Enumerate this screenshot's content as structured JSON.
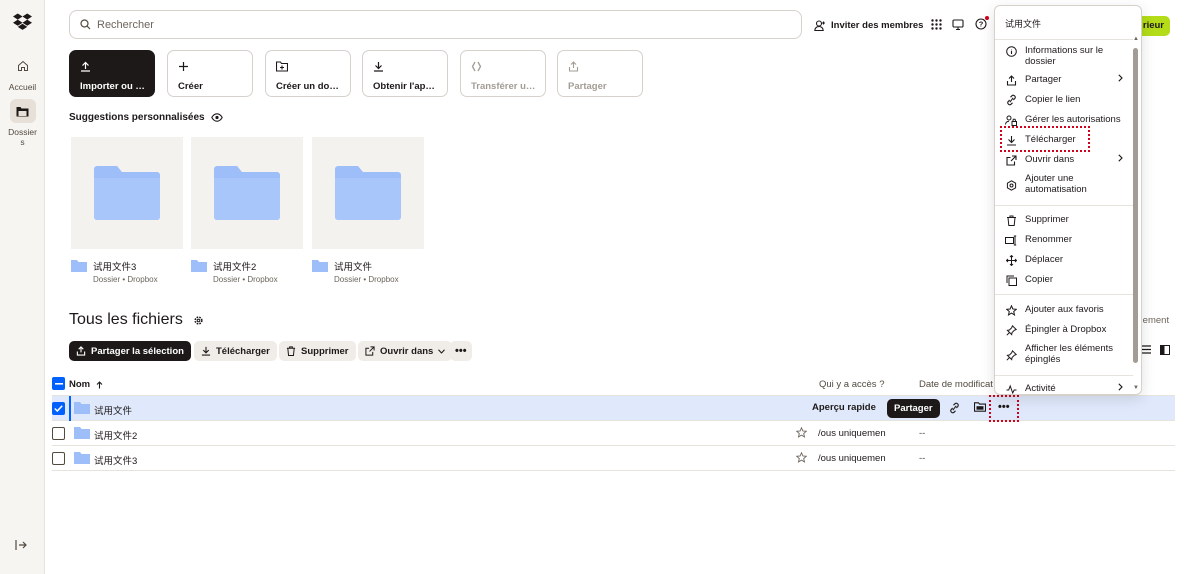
{
  "nav": {
    "home_label": "Accueil",
    "folders_label": "Dossiers"
  },
  "search": {
    "placeholder": "Rechercher"
  },
  "header": {
    "invite_label": "Inviter des membres",
    "upgrade_label": "rieur"
  },
  "actions": [
    {
      "label": "Importer ou dé…",
      "icon": "upload-icon"
    },
    {
      "label": "Créer",
      "icon": "plus-icon"
    },
    {
      "label": "Créer un dossier",
      "icon": "new-folder-icon"
    },
    {
      "label": "Obtenir l'applic…",
      "icon": "download-icon"
    },
    {
      "label": "Transférer une …",
      "icon": "transfer-icon"
    },
    {
      "label": "Partager",
      "icon": "share-icon"
    }
  ],
  "suggestions": {
    "title": "Suggestions personnalisées",
    "items": [
      {
        "name": "试用文件3",
        "sub": "Dossier • Dropbox"
      },
      {
        "name": "试用文件2",
        "sub": "Dossier • Dropbox"
      },
      {
        "name": "试用文件",
        "sub": "Dossier • Dropbox"
      }
    ]
  },
  "files": {
    "title": "Tous les fichiers",
    "partial_label": "iquement",
    "toolbar": {
      "share_selection": "Partager la sélection",
      "download": "Télécharger",
      "delete": "Supprimer",
      "open_in": "Ouvrir dans"
    },
    "columns": {
      "name": "Nom",
      "access": "Qui y a accès ?",
      "modified": "Date de modificat"
    },
    "rows": [
      {
        "name": "试用文件",
        "access": "",
        "date": "",
        "selected": true
      },
      {
        "name": "试用文件2",
        "access": "/ous uniquemen",
        "date": "--",
        "selected": false
      },
      {
        "name": "试用文件3",
        "access": "/ous uniquemen",
        "date": "--",
        "selected": false
      }
    ],
    "row_actions": {
      "preview": "Aperçu rapide",
      "share": "Partager"
    }
  },
  "menu": {
    "title": "试用文件",
    "items": [
      {
        "label": "Informations sur le dossier",
        "icon": "info-icon"
      },
      {
        "label": "Partager",
        "icon": "share-icon"
      },
      {
        "label": "Copier le lien",
        "icon": "link-icon"
      },
      {
        "label": "Gérer les autorisations",
        "icon": "permissions-icon"
      },
      {
        "label": "Télécharger",
        "icon": "download-icon"
      },
      {
        "label": "Ouvrir dans",
        "icon": "open-external-icon"
      },
      {
        "label": "Ajouter une automatisation",
        "icon": "automation-icon"
      },
      {
        "label": "Supprimer",
        "icon": "trash-icon"
      },
      {
        "label": "Renommer",
        "icon": "rename-icon"
      },
      {
        "label": "Déplacer",
        "icon": "move-icon"
      },
      {
        "label": "Copier",
        "icon": "copy-icon"
      },
      {
        "label": "Ajouter aux favoris",
        "icon": "star-icon"
      },
      {
        "label": "Épingler à Dropbox",
        "icon": "pin-icon"
      },
      {
        "label": "Afficher les éléments épinglés",
        "icon": "pin-icon"
      },
      {
        "label": "Activité",
        "icon": "activity-icon"
      }
    ]
  },
  "colors": {
    "accent": "#0061fe",
    "upgrade": "#b4dc19",
    "highlight": "#d0021b",
    "dark": "#1e1919"
  }
}
